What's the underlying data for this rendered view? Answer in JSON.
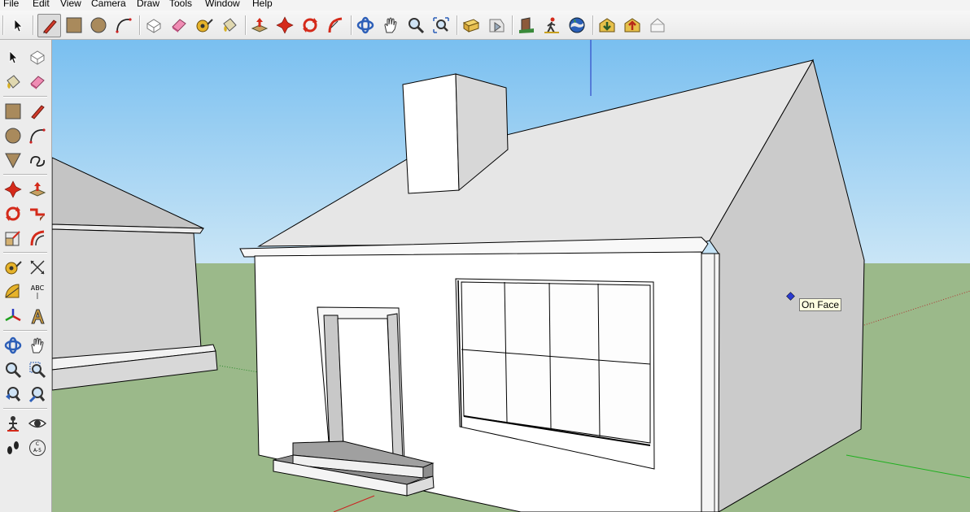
{
  "menu": [
    "File",
    "Edit",
    "View",
    "Camera",
    "Draw",
    "Tools",
    "Window",
    "Help"
  ],
  "toolbar": {
    "buttons": [
      "select-icon",
      "line-icon",
      "rectangle-icon",
      "circle-icon",
      "arc-icon",
      "make-component-icon",
      "eraser-icon",
      "tape-measure-icon",
      "paint-bucket-icon",
      "push-pull-icon",
      "move-icon",
      "rotate-icon",
      "follow-me-icon",
      "orbit-icon",
      "pan-icon",
      "zoom-icon",
      "zoom-extents-icon",
      "get-models-icon",
      "share-model-icon",
      "get-photo-texture-icon",
      "walk-icon",
      "google-earth-icon",
      "warehouse-get-icon",
      "warehouse-share-icon",
      "component-icon"
    ],
    "active": "line-icon"
  },
  "left_toolbar": {
    "buttons": [
      "select-icon",
      "make-component-icon",
      "paint-bucket-icon",
      "eraser-icon",
      "rectangle-icon",
      "line-icon",
      "circle-icon",
      "arc-icon",
      "polygon-icon",
      "freehand-icon",
      "move-icon",
      "push-pull-icon",
      "rotate-icon",
      "follow-me-icon",
      "scale-icon",
      "offset-icon",
      "tape-measure-icon",
      "dimension-icon",
      "protractor-icon",
      "text-icon",
      "axes-icon",
      "3d-text-icon",
      "orbit-icon",
      "pan-icon",
      "zoom-icon",
      "zoom-window-icon",
      "previous-view-icon",
      "zoom-extents-icon",
      "position-camera-icon",
      "look-around-icon",
      "walk-icon",
      "section-plane-icon"
    ],
    "labels": {
      "text_tool": "ABC",
      "section_tool": "C\nA-5"
    }
  },
  "viewport": {
    "tooltip": "On Face",
    "colors": {
      "sky_top": "#79bff0",
      "sky_bottom": "#cbe6f6",
      "ground": "#9bb98a",
      "roof": "#e4e4e4",
      "side_wall": "#c8c8c8",
      "front_wall": "#ffffff",
      "axis_red": "#cc2020",
      "axis_green": "#1fb01f",
      "axis_blue": "#2030c0"
    }
  }
}
